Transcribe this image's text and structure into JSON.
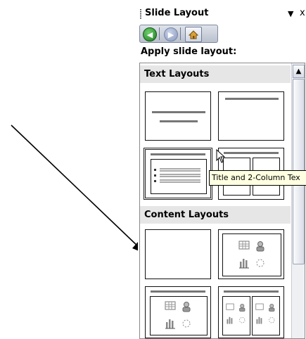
{
  "pane": {
    "title": "Slide Layout",
    "dropdown_icon": "▼",
    "close_icon": "x",
    "nav": {
      "back_icon": "back-arrow-icon",
      "forward_icon": "forward-arrow-icon",
      "home_icon": "home-icon"
    },
    "apply_label": "Apply slide layout:",
    "sections": [
      {
        "heading": "Text Layouts"
      },
      {
        "heading": "Content Layouts"
      }
    ],
    "tooltip": "Title and 2-Column Tex"
  },
  "colors": {
    "section_bg": "#e6e6e6",
    "tooltip_bg": "#ffffe1",
    "nav_back": "#1d7d1d"
  }
}
